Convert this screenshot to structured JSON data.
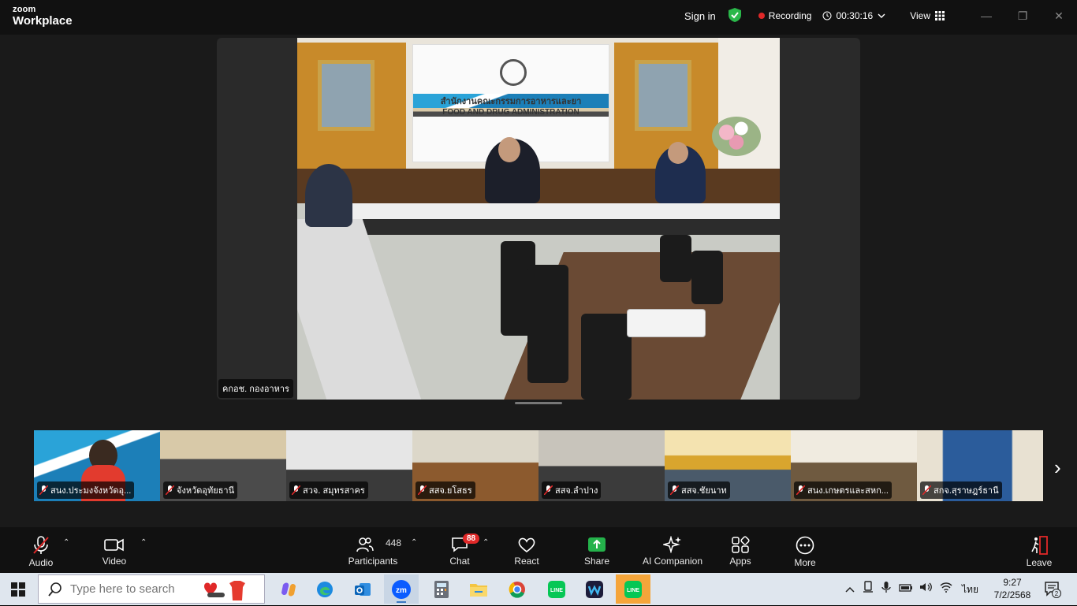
{
  "app": {
    "logo_top": "zoom",
    "logo_bottom": "Workplace"
  },
  "titlebar": {
    "signin": "Sign in",
    "recording": "Recording",
    "timer": "00:30:16",
    "view": "View"
  },
  "main_video": {
    "participant_name": "คกอช. กองอาหาร",
    "sign_line1": "สำนักงานคณะกรรมการอาหารและยา",
    "sign_line2": "FOOD AND DRUG ADMINISTRATION"
  },
  "gallery": [
    {
      "name": "สนง.ประมงจังหวัดอุ..."
    },
    {
      "name": "จังหวัดอุทัยธานี"
    },
    {
      "name": "สวจ. สมุทรสาคร"
    },
    {
      "name": "สสจ.ยโสธร"
    },
    {
      "name": "สสจ.ลำปาง"
    },
    {
      "name": "สสจ.ชัยนาท"
    },
    {
      "name": "สนง.เกษตรและสหก..."
    },
    {
      "name": "สกจ.สุราษฎร์ธานี"
    }
  ],
  "toolbar": {
    "audio": "Audio",
    "video": "Video",
    "participants": "Participants",
    "participants_count": "448",
    "chat": "Chat",
    "chat_badge": "88",
    "react": "React",
    "share": "Share",
    "ai_companion": "AI Companion",
    "apps": "Apps",
    "more": "More",
    "leave": "Leave"
  },
  "taskbar": {
    "search_placeholder": "Type here to search",
    "language": "ไทย",
    "time": "9:27",
    "date": "7/2/2568",
    "notification_count": "2"
  },
  "colors": {
    "recording": "#e02828",
    "share_green": "#24b24b",
    "shield_green": "#2ab84a",
    "leave_red": "#e02828"
  }
}
